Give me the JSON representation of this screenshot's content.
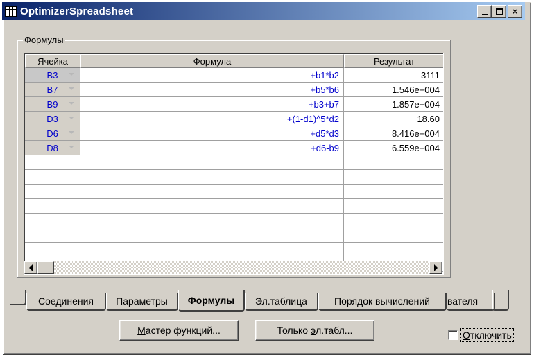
{
  "window": {
    "title": "OptimizerSpreadsheet",
    "title_color": "#0a246a",
    "icon": "spreadsheet-grid-icon"
  },
  "group": {
    "label_first": "Ф",
    "label_rest": "ормулы"
  },
  "grid": {
    "columns": [
      "Ячейка",
      "Формула",
      "Результат"
    ],
    "rows": [
      {
        "cell": "B3",
        "formula": "+b1*b2",
        "result": "3111"
      },
      {
        "cell": "B7",
        "formula": "+b5*b6",
        "result": "1.546e+004"
      },
      {
        "cell": "B9",
        "formula": "+b3+b7",
        "result": "1.857e+004"
      },
      {
        "cell": "D3",
        "formula": "+(1-d1)^5*d2",
        "result": "18.60"
      },
      {
        "cell": "D6",
        "formula": "+d5*d3",
        "result": "8.416e+004"
      },
      {
        "cell": "D8",
        "formula": "+d6-b9",
        "result": "6.559e+004"
      }
    ],
    "formula_color": "#0000cc"
  },
  "tabs": [
    {
      "label": "Соединения",
      "active": false
    },
    {
      "label": "Параметры",
      "active": false
    },
    {
      "label": "Формулы",
      "active": true
    },
    {
      "label": "Эл.таблица",
      "active": false
    },
    {
      "label": "Порядок вычислений",
      "active": false
    },
    {
      "label": "вателя",
      "active": false
    }
  ],
  "buttons": {
    "wizard_pre": "",
    "wizard_ul": "М",
    "wizard_post": "астер функций...",
    "sheet_pre": "Только ",
    "sheet_ul": "э",
    "sheet_post": "л.табл..."
  },
  "checkbox": {
    "label_ul": "О",
    "label_rest": "тключить",
    "checked": false
  }
}
